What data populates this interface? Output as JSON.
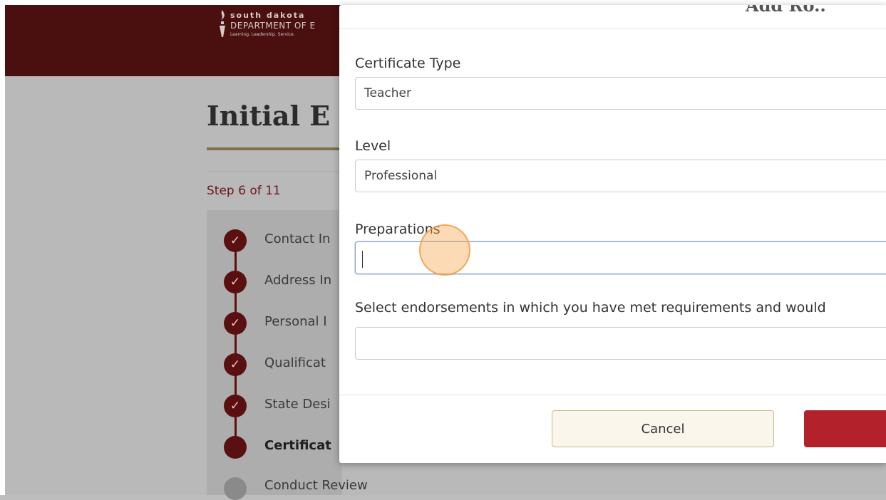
{
  "header": {
    "logo_line1": "south dakota",
    "logo_line2": "DEPARTMENT OF E",
    "logo_line3": "Learning. Leadership. Service."
  },
  "page": {
    "title": "Initial E",
    "step_count": "Step 6 of 11"
  },
  "steps": [
    {
      "label": "Contact In",
      "status": "complete",
      "icon": "check-icon",
      "glyph": "✓"
    },
    {
      "label": "Address In",
      "status": "complete",
      "icon": "check-icon",
      "glyph": "✓"
    },
    {
      "label": "Personal I",
      "status": "complete",
      "icon": "check-icon",
      "glyph": "✓"
    },
    {
      "label": "Qualificat",
      "status": "complete",
      "icon": "check-icon",
      "glyph": "✓"
    },
    {
      "label": "State Desi",
      "status": "complete",
      "icon": "check-icon",
      "glyph": "✓"
    },
    {
      "label": "Certificat",
      "status": "current",
      "icon": "current-dot",
      "glyph": ""
    },
    {
      "label": "Conduct Review",
      "status": "pending",
      "icon": "pending-dot",
      "glyph": ""
    }
  ],
  "modal": {
    "title": "Add Ro..",
    "fields": {
      "certificate_type": {
        "label": "Certificate Type",
        "value": "Teacher"
      },
      "level": {
        "label": "Level",
        "value": "Professional"
      },
      "preparations": {
        "label": "Preparations",
        "value": ""
      },
      "endorsements": {
        "label": "Select endorsements in which you have met requirements and would",
        "value": ""
      }
    },
    "cancel_label": "Cancel"
  },
  "colors": {
    "header_bg": "#4a1010",
    "accent": "#6e1818",
    "primary_button": "#b3222a",
    "cancel_bg": "#faf6ec"
  }
}
